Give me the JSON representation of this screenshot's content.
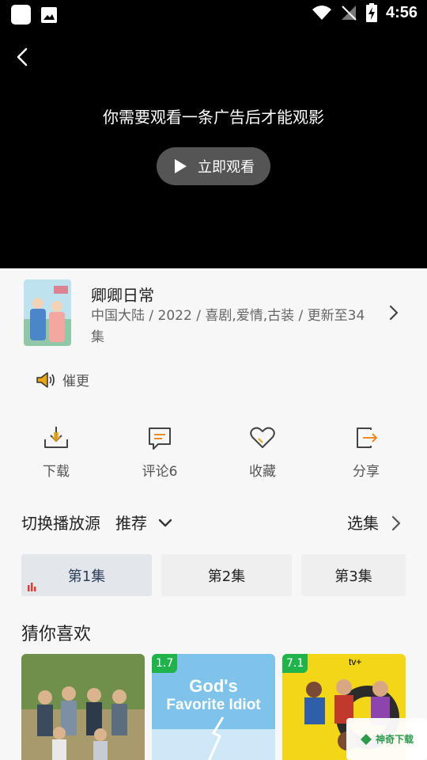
{
  "status_bar": {
    "time": "4:56"
  },
  "video": {
    "ad_message": "你需要观看一条广告后才能观影",
    "watch_button": "立即观看"
  },
  "show": {
    "title": "卿卿日常",
    "meta": "中国大陆 / 2022 / 喜剧,爱情,古装 / 更新至34集"
  },
  "urge_label": "催更",
  "actions": [
    {
      "label": "下载",
      "icon": "download-icon"
    },
    {
      "label": "评论6",
      "icon": "comment-icon"
    },
    {
      "label": "收藏",
      "icon": "heart-icon"
    },
    {
      "label": "分享",
      "icon": "share-icon"
    }
  ],
  "source": {
    "label": "切换播放源",
    "value": "推荐",
    "episodes_label": "选集"
  },
  "episodes": [
    "第1集",
    "第2集",
    "第3集"
  ],
  "recommend": {
    "title": "猜你喜欢",
    "items": [
      {
        "rating": ""
      },
      {
        "rating": "1.7",
        "poster_text": "God's Favorite Idiot"
      },
      {
        "rating": "7.1",
        "poster_text": "tv+"
      }
    ]
  },
  "watermark": "神奇下载",
  "colors": {
    "accent_green": "#20b34b",
    "icon_gold": "#e8a317",
    "icon_orange": "#f08a24",
    "episode_active": "#2b3d5a",
    "eq_red": "#e53935"
  }
}
